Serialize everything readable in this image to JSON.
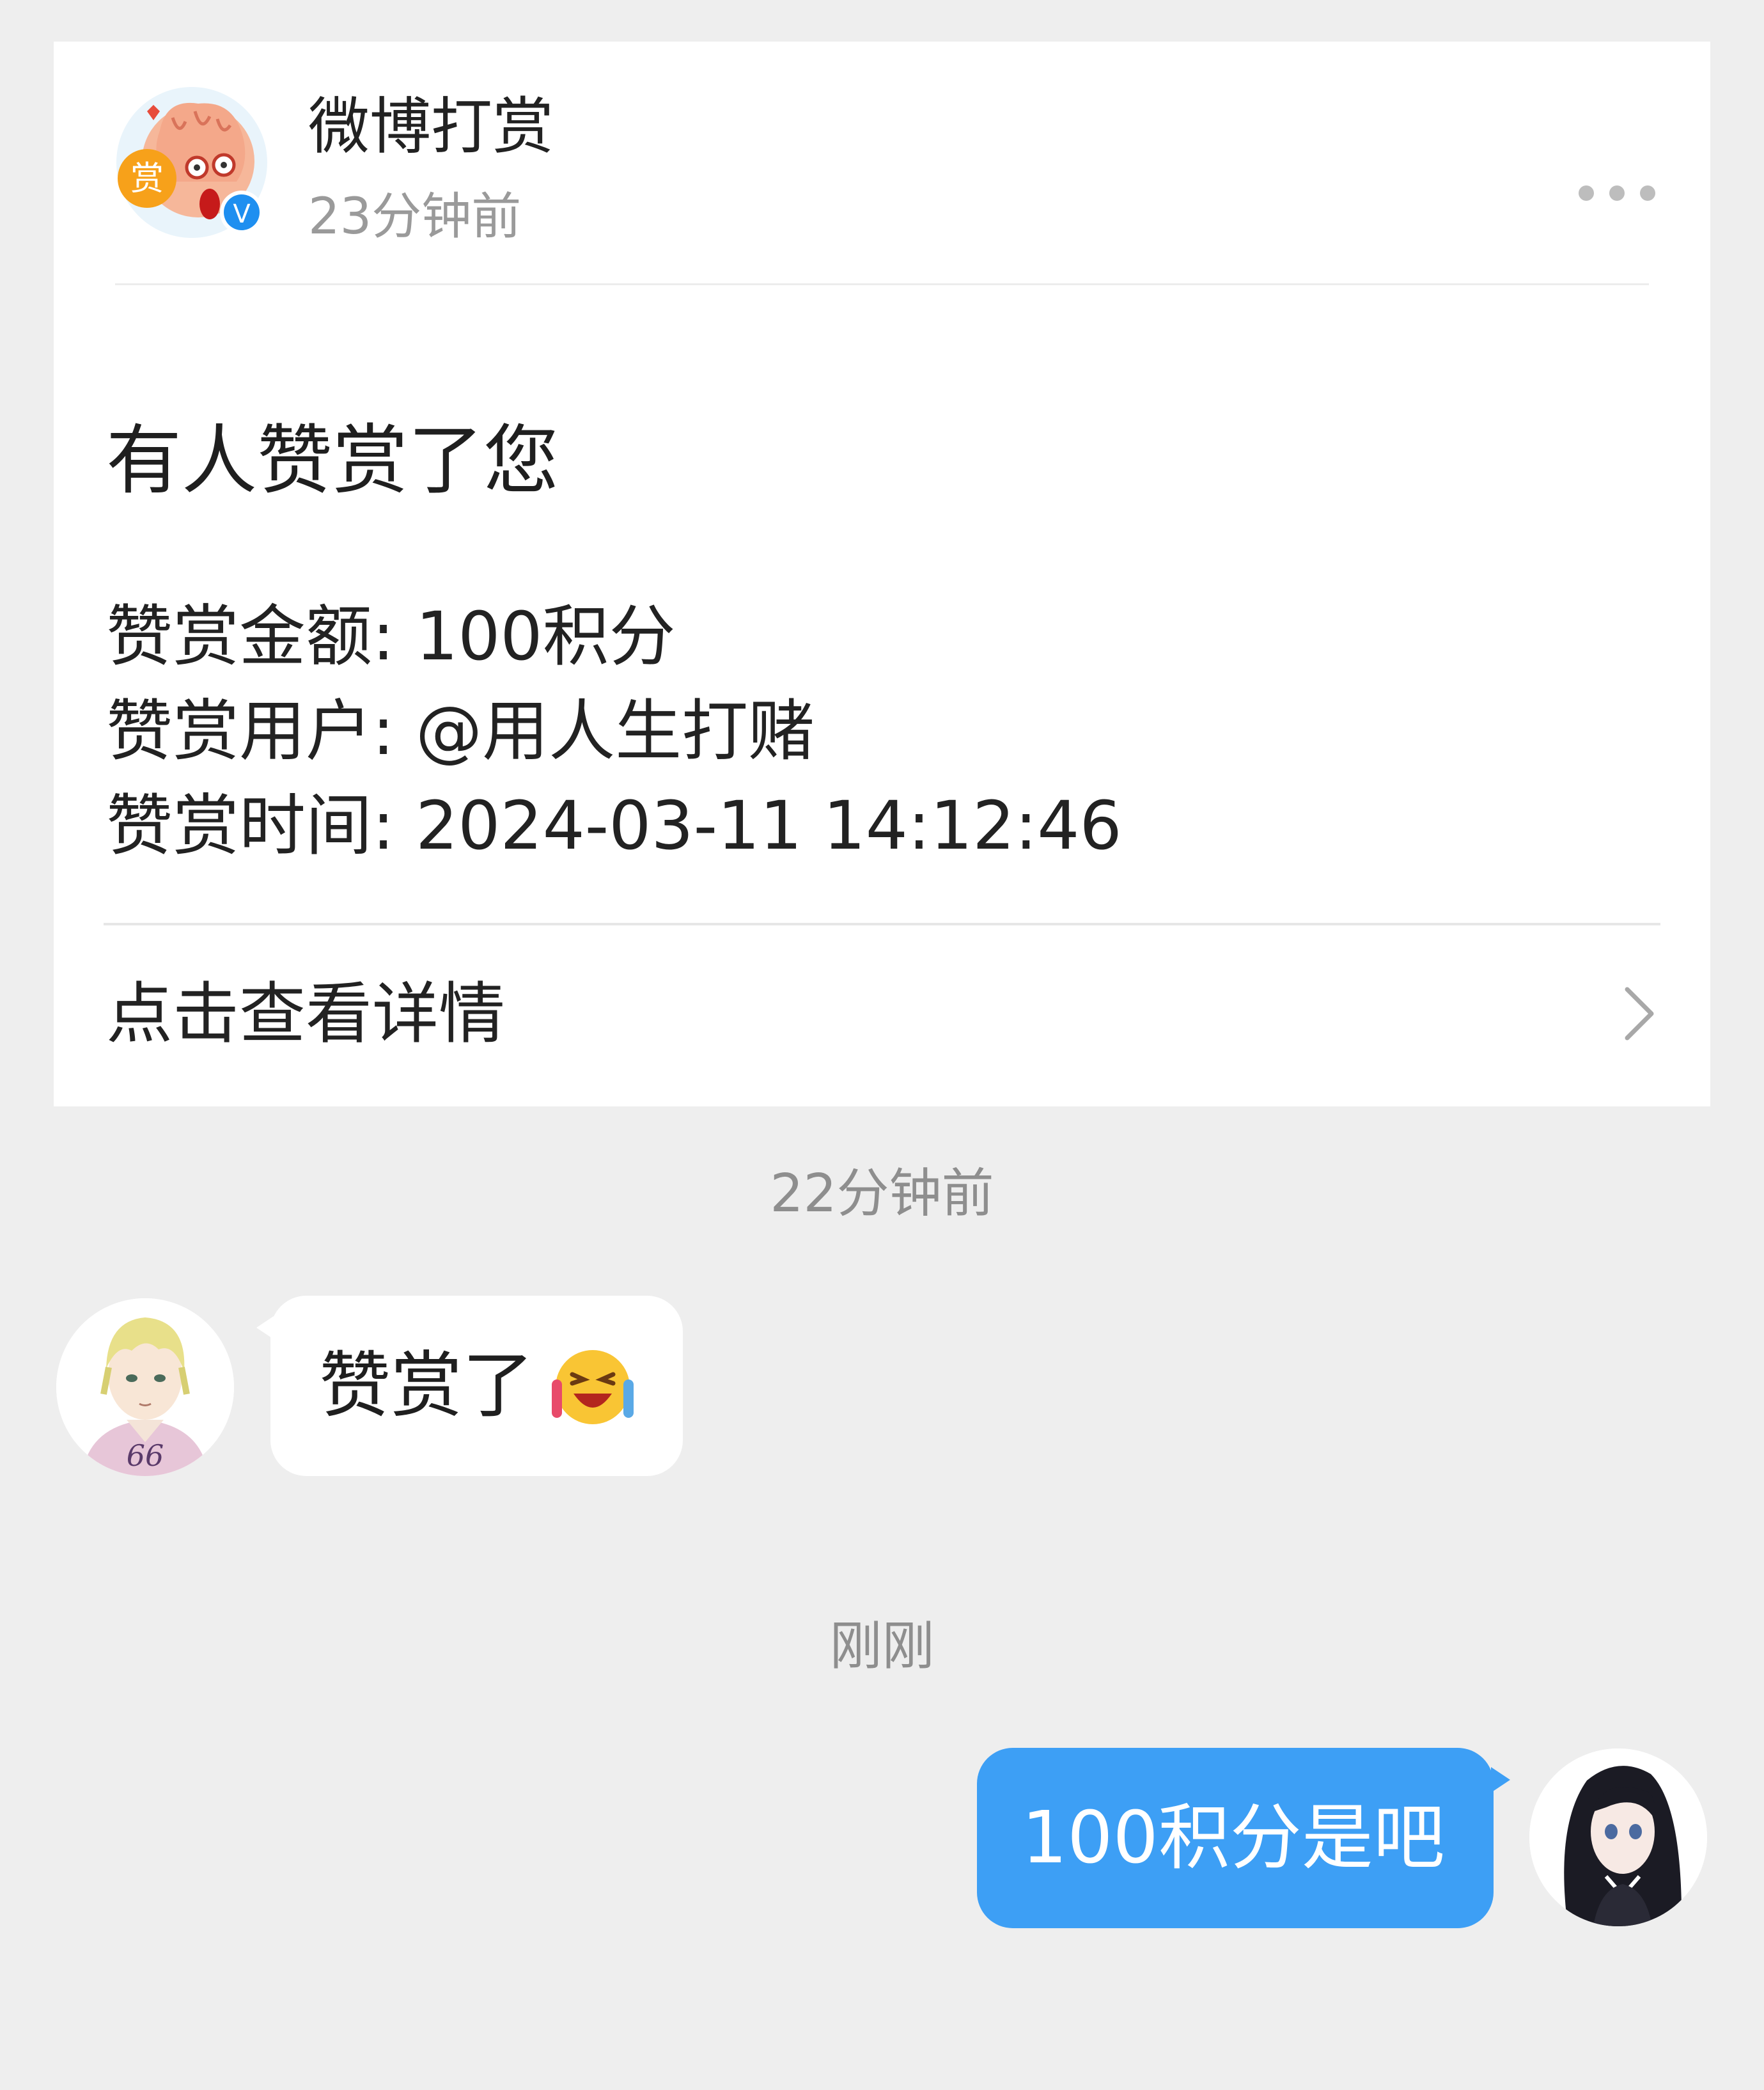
{
  "notification": {
    "sender_name": "微博打赏",
    "sender_time": "23分钟前",
    "avatar_badge": "赏",
    "verified_badge": "V",
    "title": "有人赞赏了您",
    "amount_line": "赞赏金额: 100积分",
    "user_line": "赞赏用户: @用人生打赌",
    "time_line": "赞赏时间: 2024-03-11 14:12:46",
    "details_link": "点击查看详情"
  },
  "chat": {
    "timestamp_1": "22分钟前",
    "incoming_text": "赞赏了",
    "incoming_emoji": "laughing-crying-emoji",
    "incoming_jersey_number": "66",
    "timestamp_2": "刚刚",
    "outgoing_text": "100积分是吧"
  },
  "colors": {
    "background": "#eeeeee",
    "card": "#ffffff",
    "outgoing_bubble": "#3d9ff5",
    "incoming_bubble": "#ffffff",
    "verified_blue": "#1e8ff0",
    "reward_orange": "#f7a11a"
  }
}
